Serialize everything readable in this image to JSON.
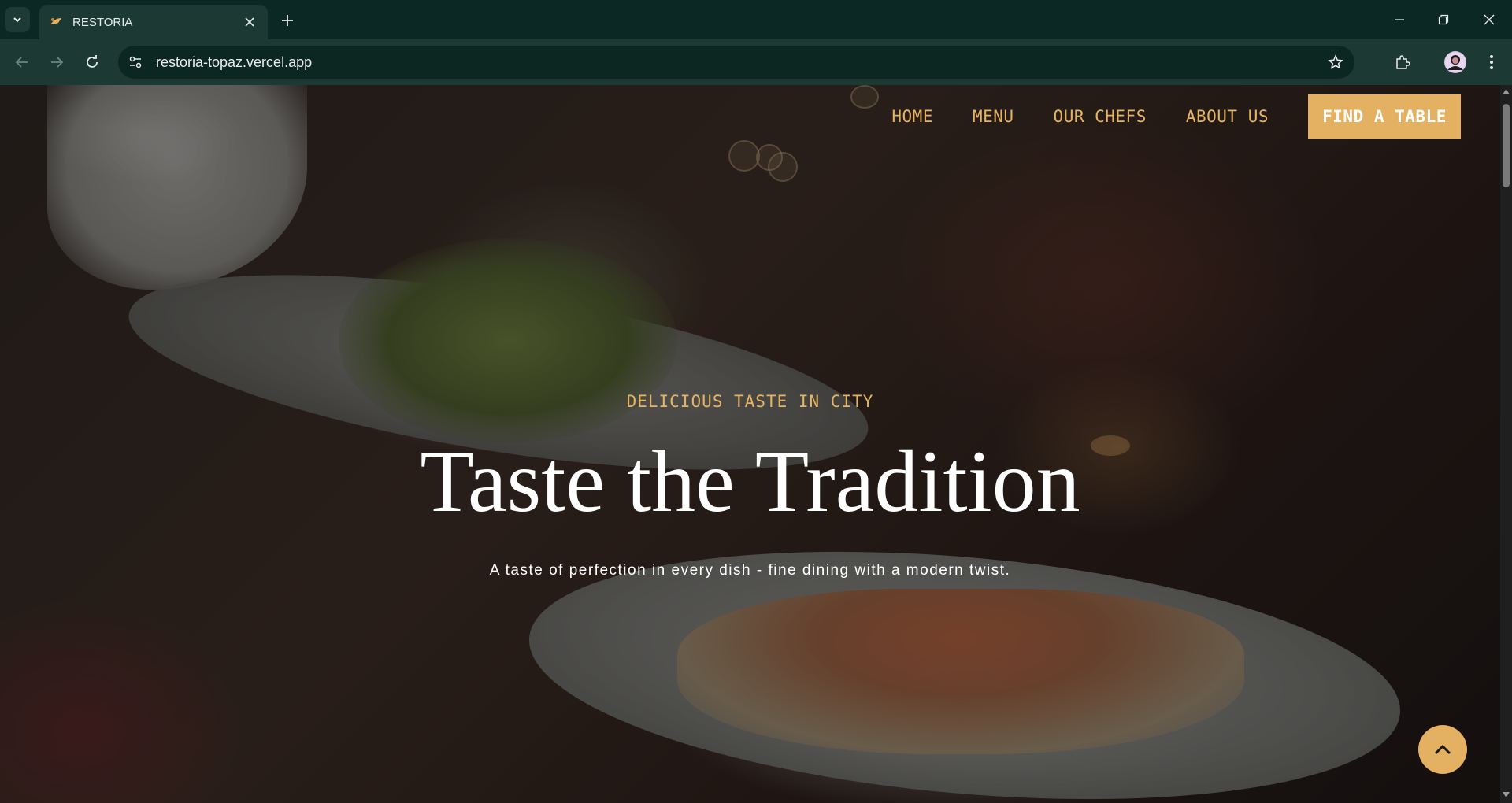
{
  "browser": {
    "tab_title": "RESTORIA",
    "url": "restoria-topaz.vercel.app"
  },
  "nav": {
    "items": [
      "HOME",
      "MENU",
      "OUR CHEFS",
      "ABOUT US"
    ],
    "cta": "FIND A TABLE"
  },
  "hero": {
    "eyebrow": "DELICIOUS TASTE IN CITY",
    "title": "Taste the Tradition",
    "subtitle": "A taste of perfection in every dish - fine dining with a modern twist."
  },
  "colors": {
    "accent": "#e4b062",
    "chrome_dark": "#0b2824",
    "chrome": "#1c3934"
  },
  "icons": {
    "back_to_top": "chevron-up-icon"
  }
}
